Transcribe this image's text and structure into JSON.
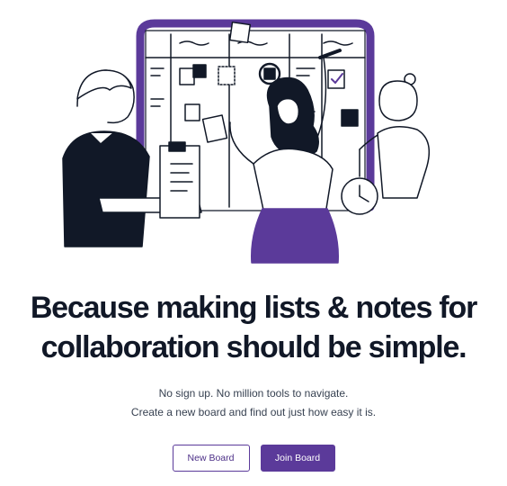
{
  "hero": {
    "headline_line1": "Because making lists & notes for",
    "headline_line2": "collaboration should be simple.",
    "subtext_line1": "No sign up. No million tools to navigate.",
    "subtext_line2": "Create a new board and find out just how easy it is."
  },
  "actions": {
    "new_board_label": "New Board",
    "join_board_label": "Join Board"
  },
  "illustration": {
    "description_icon": "team-collaboration-board-illustration"
  },
  "colors": {
    "accent": "#5b3a9a",
    "ink": "#111827",
    "text_muted": "#374151",
    "background": "#ffffff"
  }
}
